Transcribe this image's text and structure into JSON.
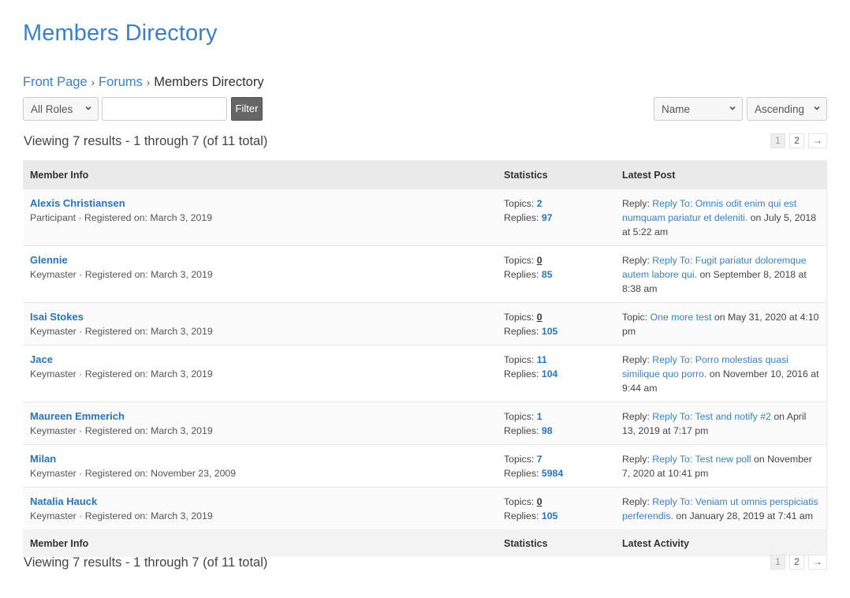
{
  "page_title": "Members Directory",
  "breadcrumb": {
    "items": [
      {
        "label": "Front Page",
        "link": true
      },
      {
        "label": "Forums",
        "link": true
      },
      {
        "label": "Members Directory",
        "link": false
      }
    ],
    "separator": "›"
  },
  "filters": {
    "role_select": {
      "selected": "All Roles"
    },
    "search_input": {
      "value": "",
      "placeholder": ""
    },
    "filter_button": "Filter",
    "sort_by_select": {
      "selected": "Name"
    },
    "order_select": {
      "selected": "Ascending"
    }
  },
  "results_summary": "Viewing 7 results - 1 through 7 (of 11 total)",
  "pagination": {
    "current_page": "1",
    "pages": [
      "1",
      "2"
    ],
    "next": "→"
  },
  "table": {
    "header": {
      "member_info": "Member Info",
      "statistics": "Statistics",
      "latest_post": "Latest Post"
    },
    "footer": {
      "member_info": "Member Info",
      "statistics": "Statistics",
      "latest_activity": "Latest Activity"
    },
    "topics_label": "Topics:",
    "replies_label": "Replies:",
    "rows": [
      {
        "name": "Alexis Christiansen",
        "meta": "Participant · Registered on: March 3, 2019",
        "topics": "2",
        "replies": "97",
        "post_type": "Reply:",
        "post_title": "Reply To: Omnis odit enim qui est numquam pariatur et deleniti.",
        "post_date": " on July 5, 2018 at 5:22 am"
      },
      {
        "name": "Glennie",
        "meta": "Keymaster · Registered on: March 3, 2019",
        "topics": "0",
        "replies": "85",
        "post_type": "Reply:",
        "post_title": "Reply To: Fugit pariatur doloremque autem labore qui.",
        "post_date": " on September 8, 2018 at 8:38 am"
      },
      {
        "name": "Isai Stokes",
        "meta": "Keymaster · Registered on: March 3, 2019",
        "topics": "0",
        "replies": "105",
        "post_type": "Topic:",
        "post_title": "One more test",
        "post_date": " on May 31, 2020 at 4:10 pm"
      },
      {
        "name": "Jace",
        "meta": "Keymaster · Registered on: March 3, 2019",
        "topics": "11",
        "replies": "104",
        "post_type": "Reply:",
        "post_title": "Reply To: Porro molestias quasi similique quo porro.",
        "post_date": " on November 10, 2016 at 9:44 am"
      },
      {
        "name": "Maureen Emmerich",
        "meta": "Keymaster · Registered on: March 3, 2019",
        "topics": "1",
        "replies": "98",
        "post_type": "Reply:",
        "post_title": "Reply To: Test and notify #2",
        "post_date": " on April 13, 2019 at 7:17 pm"
      },
      {
        "name": "Milan",
        "meta": "Keymaster · Registered on: November 23, 2009",
        "topics": "7",
        "replies": "5984",
        "post_type": "Reply:",
        "post_title": "Reply To: Test new poll",
        "post_date": " on November 7, 2020 at 10:41 pm"
      },
      {
        "name": "Natalia Hauck",
        "meta": "Keymaster · Registered on: March 3, 2019",
        "topics": "0",
        "replies": "105",
        "post_type": "Reply:",
        "post_title": "Reply To: Veniam ut omnis perspiciatis perferendis.",
        "post_date": " on January 28, 2019 at 7:41 am"
      }
    ]
  },
  "colors": {
    "link": "#2c73b9",
    "title": "#3b80c7",
    "header_bg": "#eaeaea",
    "filter_button_bg": "#666666"
  }
}
